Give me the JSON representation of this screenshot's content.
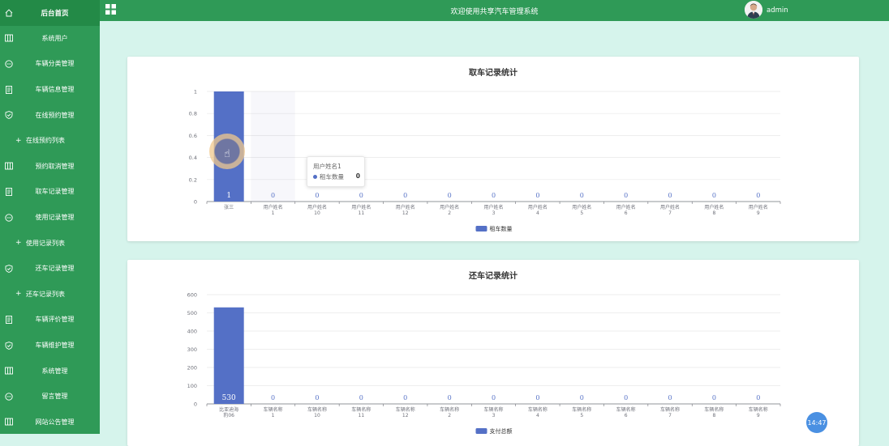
{
  "sidebar": {
    "home_label": "后台首页",
    "items": [
      {
        "label": "系统用户",
        "icon": "columns-icon",
        "sub": false
      },
      {
        "label": "车辆分类管理",
        "icon": "chat-icon",
        "sub": false
      },
      {
        "label": "车辆信息管理",
        "icon": "document-icon",
        "sub": false
      },
      {
        "label": "在线预约管理",
        "icon": "shield-icon",
        "sub": false
      },
      {
        "label": "在线预约列表",
        "icon": "plus-icon",
        "sub": true
      },
      {
        "label": "预约取消管理",
        "icon": "columns-icon",
        "sub": false
      },
      {
        "label": "取车记录管理",
        "icon": "document-icon",
        "sub": false
      },
      {
        "label": "使用记录管理",
        "icon": "chat-icon",
        "sub": false
      },
      {
        "label": "使用记录列表",
        "icon": "plus-icon",
        "sub": true
      },
      {
        "label": "还车记录管理",
        "icon": "shield-icon",
        "sub": false
      },
      {
        "label": "还车记录列表",
        "icon": "plus-icon",
        "sub": true
      },
      {
        "label": "车辆评价管理",
        "icon": "document-icon",
        "sub": false
      },
      {
        "label": "车辆维护管理",
        "icon": "shield-icon",
        "sub": false
      },
      {
        "label": "系统管理",
        "icon": "columns-icon",
        "sub": false
      },
      {
        "label": "留言管理",
        "icon": "chat-icon",
        "sub": false
      },
      {
        "label": "网站公告管理",
        "icon": "columns-icon",
        "sub": false
      }
    ]
  },
  "topbar": {
    "title": "欢迎使用共享汽车管理系统",
    "username": "admin"
  },
  "colors": {
    "sidebar": "#2f9a57",
    "sidebar_top": "#238a47",
    "bar": "#5470c6",
    "background": "#d6f4ec"
  },
  "chart_data": [
    {
      "type": "bar",
      "title": "取车记录统计",
      "categories": [
        "张三",
        "用户姓名1",
        "用户姓名10",
        "用户姓名11",
        "用户姓名12",
        "用户姓名2",
        "用户姓名3",
        "用户姓名4",
        "用户姓名5",
        "用户姓名6",
        "用户姓名7",
        "用户姓名8",
        "用户姓名9"
      ],
      "series": [
        {
          "name": "租车数量",
          "values": [
            1,
            0,
            0,
            0,
            0,
            0,
            0,
            0,
            0,
            0,
            0,
            0,
            0
          ]
        }
      ],
      "ylim": [
        0,
        1
      ],
      "yticks": [
        "0",
        "0.2",
        "0.4",
        "0.6",
        "0.8",
        "1"
      ],
      "legend": "bottom-center",
      "grid": true,
      "tooltip": {
        "title": "用户姓名1",
        "label": "租车数量",
        "value": "0"
      }
    },
    {
      "type": "bar",
      "title": "还车记录统计",
      "categories": [
        "比亚迪海豹06",
        "车辆名称1",
        "车辆名称10",
        "车辆名称11",
        "车辆名称12",
        "车辆名称2",
        "车辆名称3",
        "车辆名称4",
        "车辆名称5",
        "车辆名称6",
        "车辆名称7",
        "车辆名称8",
        "车辆名称9"
      ],
      "series": [
        {
          "name": "支付总额",
          "values": [
            530,
            0,
            0,
            0,
            0,
            0,
            0,
            0,
            0,
            0,
            0,
            0,
            0
          ]
        }
      ],
      "ylim": [
        0,
        600
      ],
      "yticks": [
        "0",
        "100",
        "200",
        "300",
        "400",
        "500",
        "600"
      ],
      "legend": "bottom-center",
      "grid": true
    }
  ],
  "clock": "14:47"
}
